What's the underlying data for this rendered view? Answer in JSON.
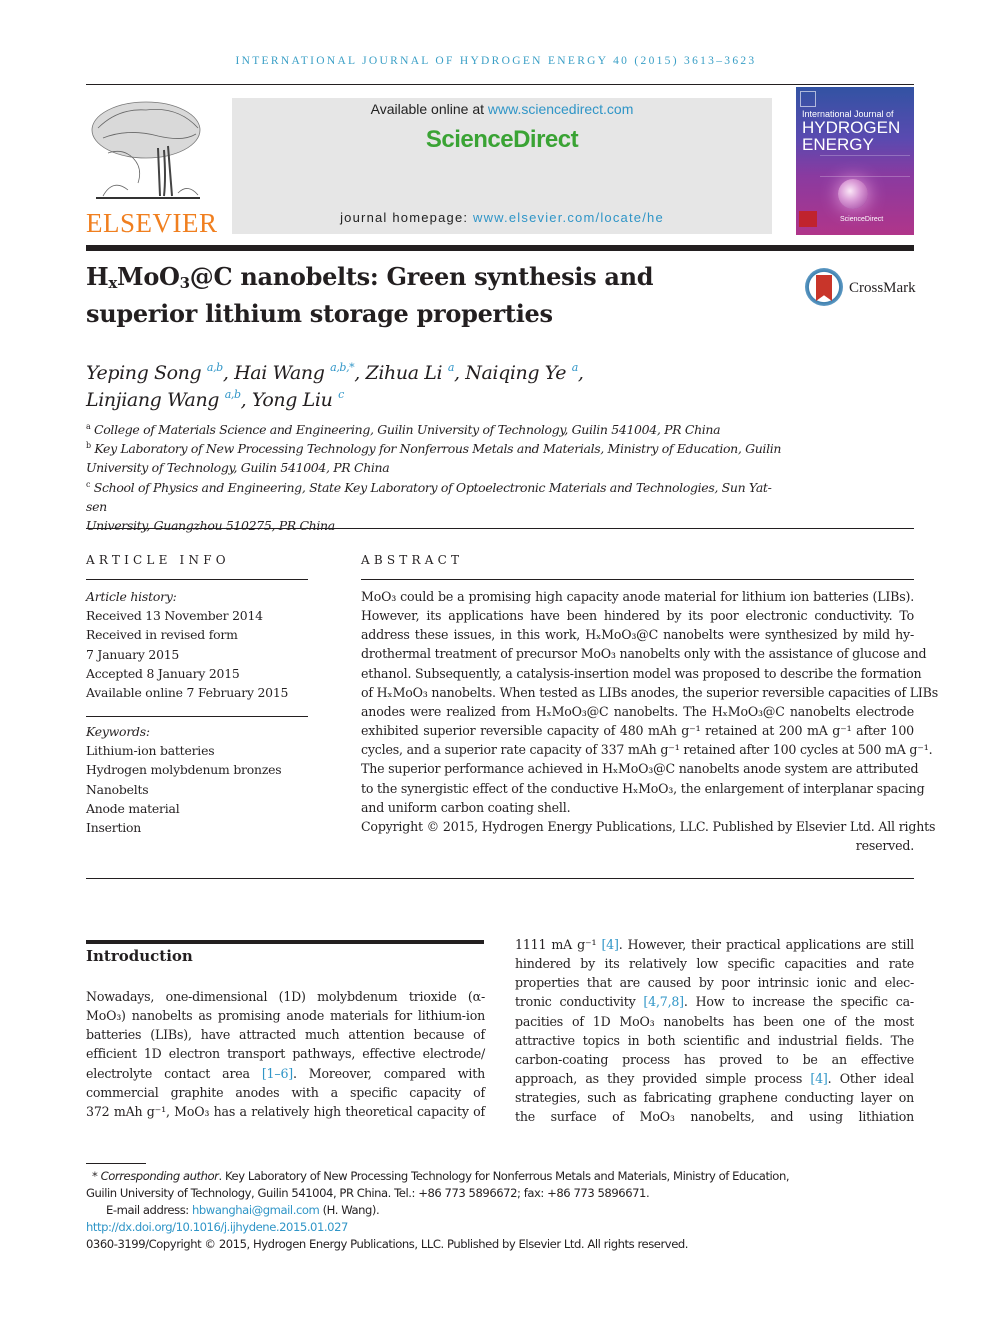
{
  "running_head": "INTERNATIONAL JOURNAL OF HYDROGEN ENERGY 40 (2015) 3613–3623",
  "publisher": {
    "name": "ELSEVIER",
    "brand_color": "#f07f1f"
  },
  "banner": {
    "available_prefix": "Available online at ",
    "available_link": "www.sciencedirect.com",
    "brand": "ScienceDirect",
    "brand_color": "#3aa334",
    "homepage_prefix": "journal homepage: ",
    "homepage_link": "www.elsevier.com/locate/he"
  },
  "cover": {
    "line1": "International Journal of",
    "line2": "HYDROGEN",
    "line3": "ENERGY",
    "footer": "ScienceDirect"
  },
  "crossmark": {
    "label": "CrossMark"
  },
  "article": {
    "title_parts": {
      "h": "H",
      "x": "x",
      "mo": "MoO",
      "three": "3",
      "rest_line1": "@C nanobelts: Green synthesis and",
      "line2": "superior lithium storage properties"
    },
    "authors": [
      {
        "name": "Yeping Song",
        "aff": "a,b"
      },
      {
        "name": "Hai Wang",
        "aff": "a,b,*"
      },
      {
        "name": "Zihua Li",
        "aff": "a"
      },
      {
        "name": "Naiqing Ye",
        "aff": "a"
      },
      {
        "name": "Linjiang Wang",
        "aff": "a,b"
      },
      {
        "name": "Yong Liu",
        "aff": "c"
      }
    ],
    "affiliations": [
      {
        "key": "a",
        "text": "College of Materials Science and Engineering, Guilin University of Technology, Guilin 541004, PR China"
      },
      {
        "key": "b",
        "line1": "Key Laboratory of New Processing Technology for Nonferrous Metals and Materials, Ministry of Education, Guilin",
        "line2": "University of Technology, Guilin 541004, PR China"
      },
      {
        "key": "c",
        "line1": "School of Physics and Engineering, State Key Laboratory of Optoelectronic Materials and Technologies, Sun Yat-sen",
        "line2": "University, Guangzhou 510275, PR China"
      }
    ]
  },
  "article_info": {
    "heading": "ARTICLE INFO",
    "history_label": "Article history:",
    "history": [
      "Received 13 November 2014",
      "Received in revised form",
      "7 January 2015",
      "Accepted 8 January 2015",
      "Available online 7 February 2015"
    ],
    "keywords_label": "Keywords:",
    "keywords": [
      "Lithium-ion batteries",
      "Hydrogen molybdenum bronzes",
      "Nanobelts",
      "Anode material",
      "Insertion"
    ]
  },
  "abstract": {
    "heading": "ABSTRACT",
    "lines": [
      "MoO₃ could be a promising high capacity anode material for lithium ion batteries (LIBs).",
      "However, its applications have been hindered by its poor electronic conductivity. To",
      "address these issues, in this work, HₓMoO₃@C nanobelts were synthesized by mild hy-",
      "drothermal treatment of precursor MoO₃ nanobelts only with the assistance of glucose and",
      "ethanol. Subsequently, a catalysis-insertion model was proposed to describe the formation",
      "of HₓMoO₃ nanobelts. When tested as LIBs anodes, the superior reversible capacities of LIBs",
      "anodes were realized from HₓMoO₃@C nanobelts. The HₓMoO₃@C nanobelts electrode",
      "exhibited superior reversible capacity of 480 mAh g⁻¹ retained at 200 mA g⁻¹ after 100",
      "cycles, and a superior rate capacity of 337 mAh g⁻¹ retained after 100 cycles at 500 mA g⁻¹.",
      "The superior performance achieved in HₓMoO₃@C nanobelts anode system are attributed",
      "to the synergistic effect of the conductive HₓMoO₃, the enlargement of interplanar spacing"
    ],
    "last_line": "and uniform carbon coating shell.",
    "copyright_line1": "Copyright © 2015, Hydrogen Energy Publications, LLC. Published by Elsevier Ltd. All rights",
    "copyright_line2": "reserved."
  },
  "introduction": {
    "heading": "Introduction",
    "col1_lines": [
      "Nowadays, one-dimensional (1D) molybdenum trioxide (α-",
      "MoO₃) nanobelts as promising anode materials for lithium-ion",
      "batteries (LIBs), have attracted much attention because of",
      "efficient 1D electron transport pathways, effective electrode/",
      "electrolyte contact area [1–6]. Moreover, compared with",
      "commercial graphite anodes with a specific capacity of",
      "372 mAh g⁻¹, MoO₃ has a relatively high theoretical capacity of"
    ],
    "col2_lines": [
      "1111 mA g⁻¹ [4]. However, their practical applications are still",
      "hindered by its relatively low specific capacities and rate",
      "properties that are caused by poor intrinsic ionic and elec-",
      "tronic conductivity [4,7,8]. How to increase the specific ca-",
      "pacities of 1D MoO₃ nanobelts has been one of the most",
      "attractive topics in both scientific and industrial fields. The",
      "carbon-coating process has proved to be an effective",
      "approach, as they provided simple process [4]. Other ideal",
      "strategies, such as fabricating graphene conducting layer on",
      "the surface of MoO₃ nanobelts, and using lithiation"
    ],
    "refs": [
      "[1–6]",
      "[4]",
      "[4,7,8]",
      "[4]"
    ]
  },
  "footnote": {
    "star": "* ",
    "corr_label": "Corresponding author",
    "corr_text": ". Key Laboratory of New Processing Technology for Nonferrous Metals and Materials, Ministry of Education,",
    "corr_line2": "Guilin University of Technology, Guilin 541004, PR China. Tel.: +86 773 5896672; fax: +86 773 5896671.",
    "email_label": "E-mail address: ",
    "email": "hbwanghai@gmail.com",
    "email_suffix": " (H. Wang).",
    "doi": "http://dx.doi.org/10.1016/j.ijhydene.2015.01.027",
    "copyright": "0360-3199/Copyright © 2015, Hydrogen Energy Publications, LLC. Published by Elsevier Ltd. All rights reserved."
  },
  "colors": {
    "link": "#2f95c7",
    "text": "#231f20",
    "banner_bg": "#e6e6e6"
  }
}
